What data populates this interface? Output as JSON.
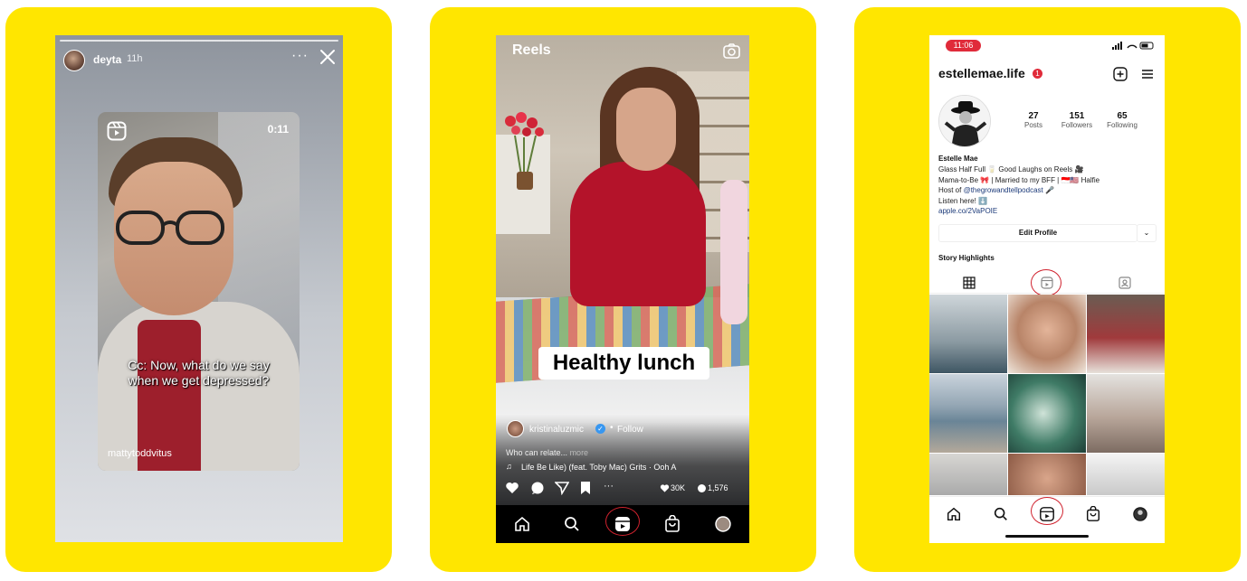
{
  "story": {
    "username": "deyta",
    "time": "11h",
    "more": "···",
    "reel": {
      "duration": "0:11",
      "caption_line1": "Cc: Now, what do we say",
      "caption_line2": "when we get depressed?",
      "author": "mattytoddvitus"
    }
  },
  "reels": {
    "title": "Reels",
    "sticker": "Healthy lunch",
    "username": "kristinaluzmic",
    "verified": "✓",
    "dot": "•",
    "follow": "Follow",
    "caption": "Who can relate...",
    "caption_more": "more",
    "music": "Life Be Like) (feat. Toby Mac)  Grits · Ooh A",
    "likes": "30K",
    "comments": "1,576",
    "more": "···"
  },
  "profile": {
    "clock": "11:06",
    "handle": "estellemae.life",
    "notif": "1",
    "stats": [
      {
        "num": "27",
        "label": "Posts"
      },
      {
        "num": "151",
        "label": "Followers"
      },
      {
        "num": "65",
        "label": "Following"
      }
    ],
    "name": "Estelle Mae",
    "bio_line1": "Glass Half Full 🥛 Good Laughs on Reels 🎥",
    "bio_line2": "Mama-to-Be 🎀 | Married to my BFF | 🇮🇩🇺🇸 Halfie",
    "bio_line3_prefix": "Host of",
    "bio_line3_link": "@thegrowandtellpodcast",
    "bio_line3_suffix": "🎤",
    "bio_line4": "Listen here! ⬇️",
    "bio_link": "apple.co/2VaPOIE",
    "edit_profile": "Edit Profile",
    "edit_more": "⌄",
    "story_highlights": "Story Highlights"
  },
  "colors": {
    "panel_yellow": "#ffe600",
    "highlight_circle": "#d0222e",
    "status_red": "#e02b3a"
  }
}
